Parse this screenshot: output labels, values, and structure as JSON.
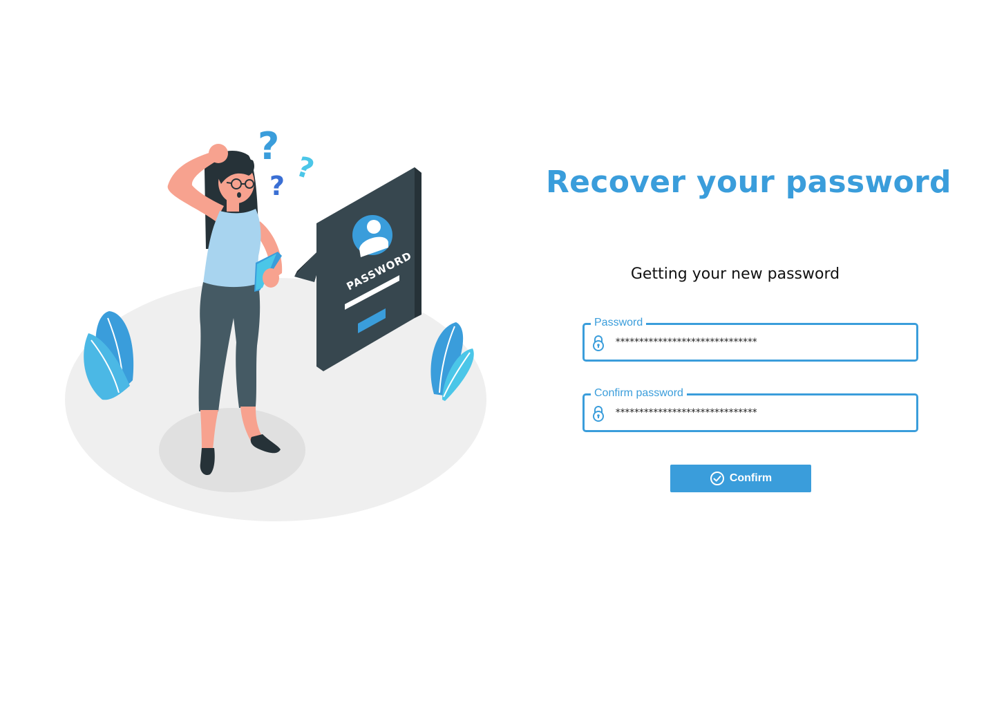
{
  "page": {
    "title": "Recover your password",
    "subtitle": "Getting your new password"
  },
  "illustration": {
    "board_text": "PASSWORD",
    "accent_color": "#3a9ddb"
  },
  "form": {
    "password": {
      "label": "Password",
      "value": "******************************",
      "icon": "lock-icon"
    },
    "confirm_password": {
      "label": "Confirm password",
      "value": "******************************",
      "icon": "lock-icon"
    },
    "confirm_button": {
      "label": "Confirm",
      "icon": "check-circle-icon"
    }
  },
  "colors": {
    "accent": "#3a9ddb",
    "text": "#111111",
    "board": "#37474f"
  }
}
